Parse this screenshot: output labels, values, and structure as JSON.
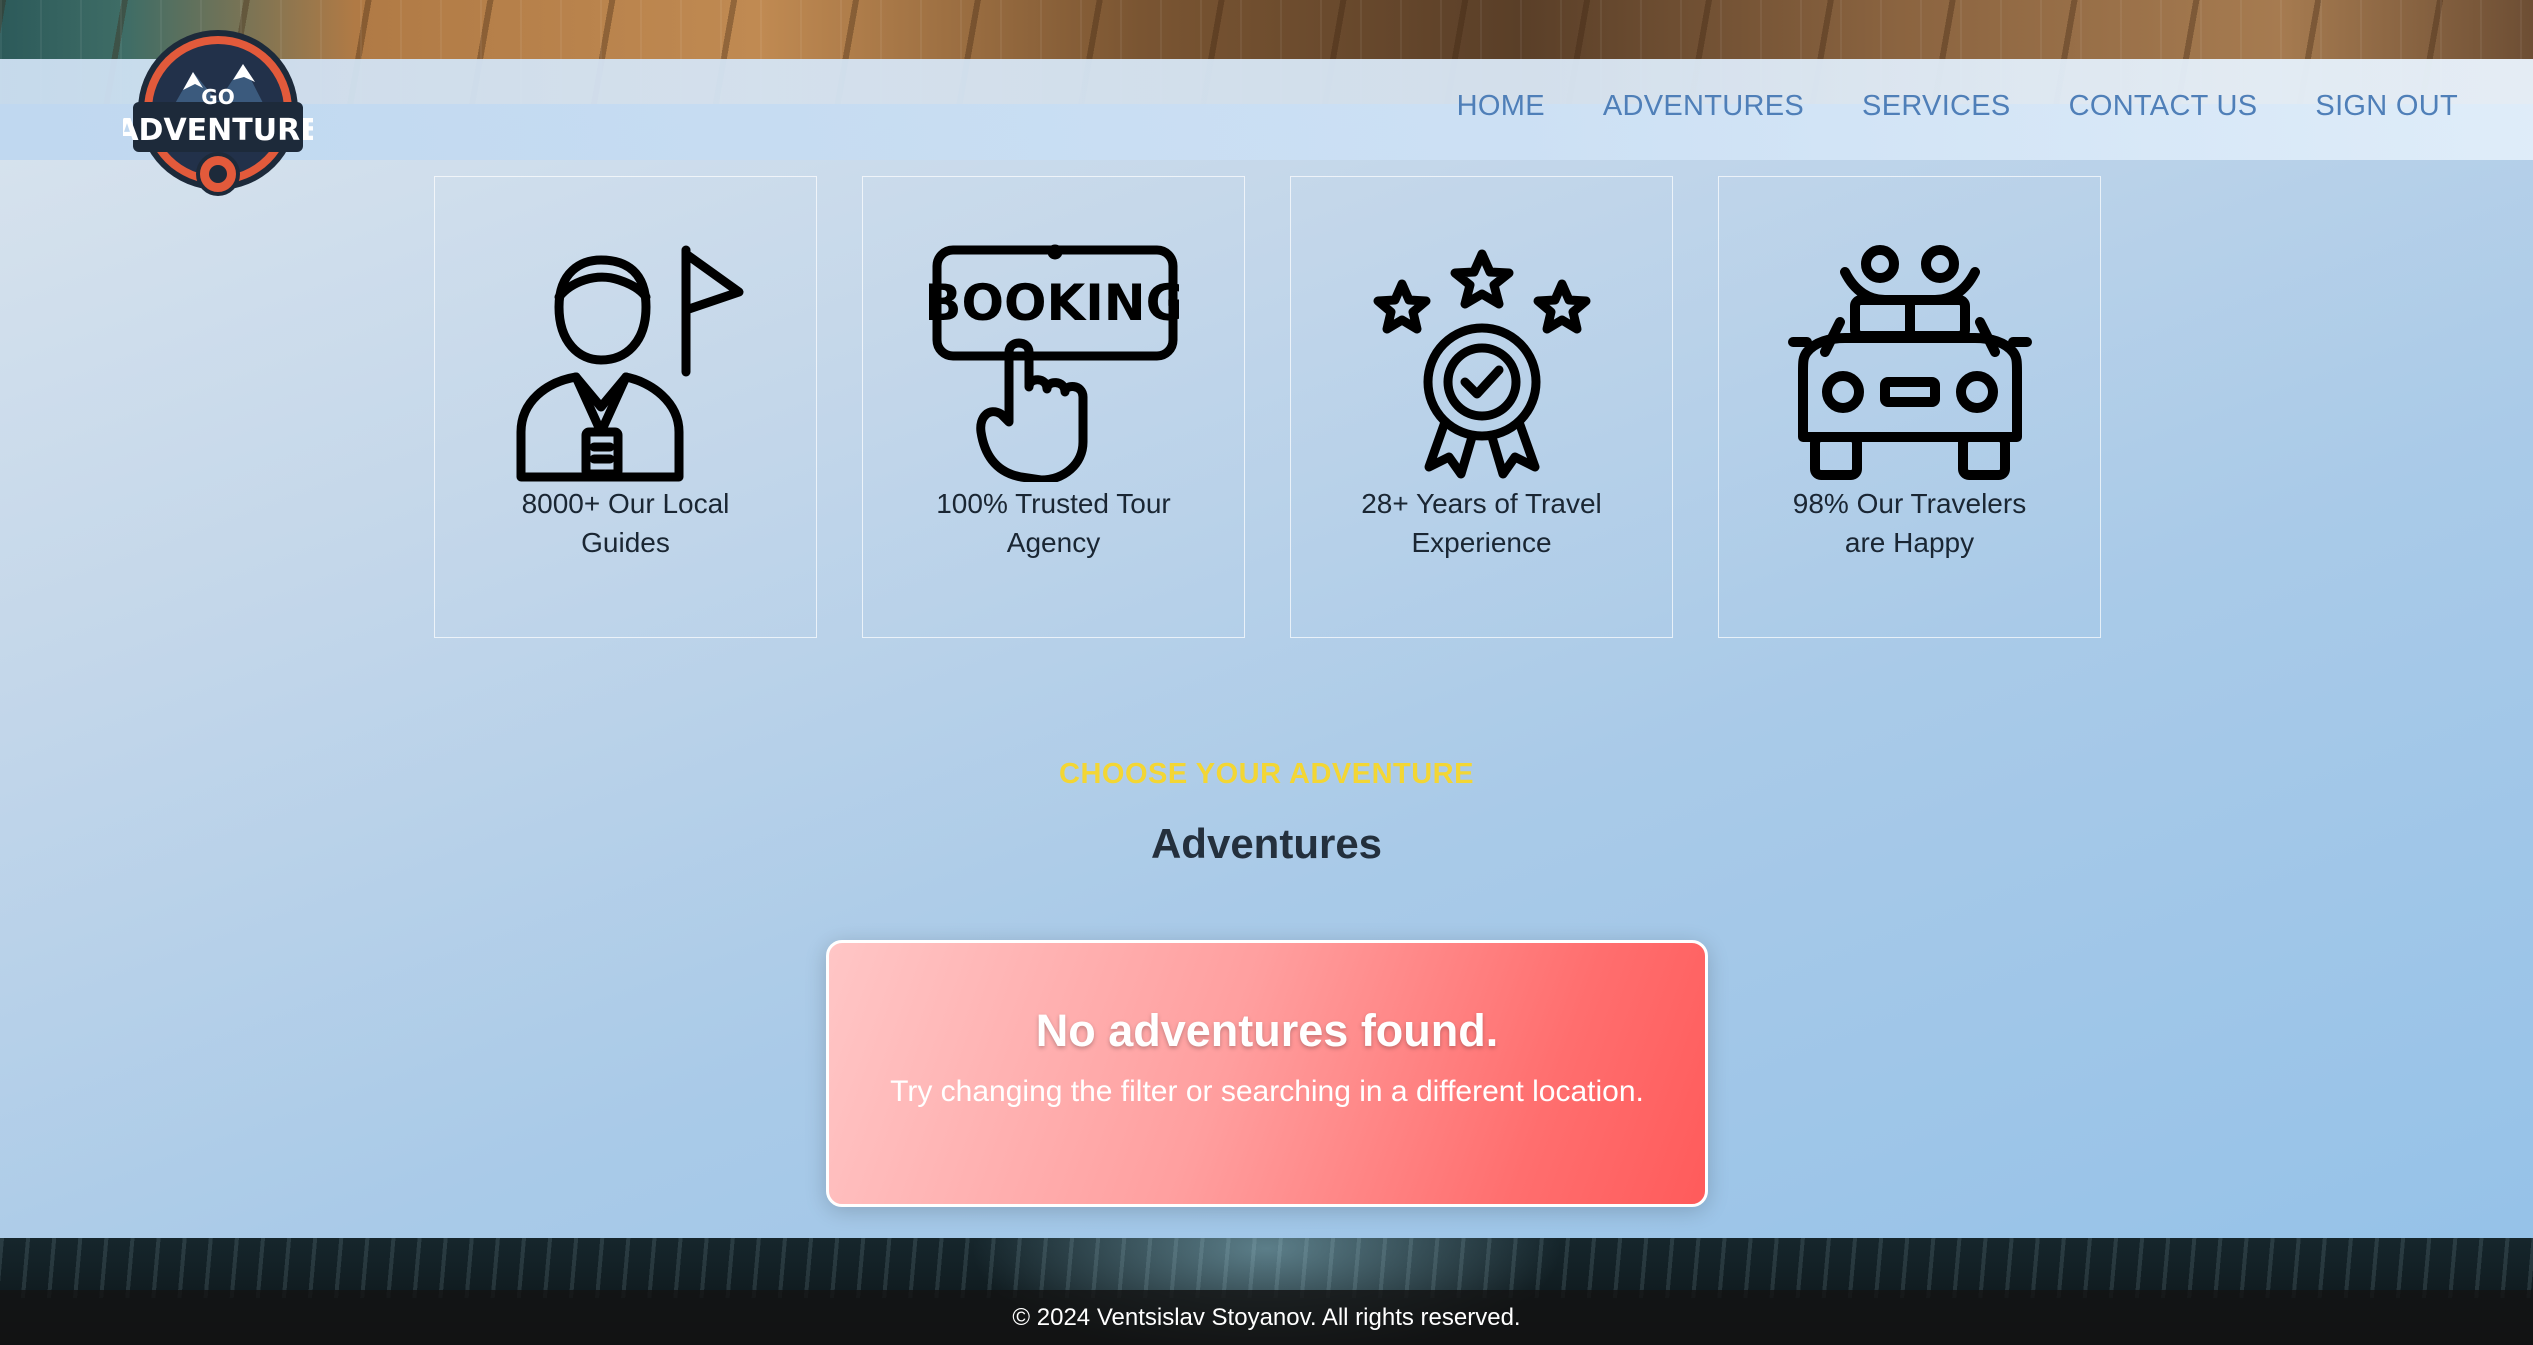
{
  "brand": {
    "logo_top": "GO",
    "logo_main": "ADVENTURE"
  },
  "nav": {
    "items": [
      {
        "label": "HOME"
      },
      {
        "label": "ADVENTURES"
      },
      {
        "label": "SERVICES"
      },
      {
        "label": "CONTACT US"
      },
      {
        "label": "SIGN OUT"
      }
    ]
  },
  "features": [
    {
      "label": "8000+ Our Local Guides",
      "icon": "guide-icon"
    },
    {
      "label": "100% Trusted Tour Agency",
      "icon": "booking-icon",
      "icon_text": "BOOKING"
    },
    {
      "label": "28+ Years of Travel Experience",
      "icon": "award-icon"
    },
    {
      "label": "98% Our Travelers are Happy",
      "icon": "car-icon"
    }
  ],
  "section": {
    "eyebrow": "CHOOSE YOUR ADVENTURE",
    "title": "Adventures"
  },
  "empty_state": {
    "title": "No adventures found.",
    "message": "Try changing the filter or searching in a different location."
  },
  "footer": {
    "copyright": "© 2024 Ventsislav Stoyanov. All rights reserved."
  },
  "colors": {
    "nav_link": "#4f7fb8",
    "eyebrow": "#f3d634",
    "empty_card_start": "#ffc6c6",
    "empty_card_end": "#ff5b5b"
  }
}
